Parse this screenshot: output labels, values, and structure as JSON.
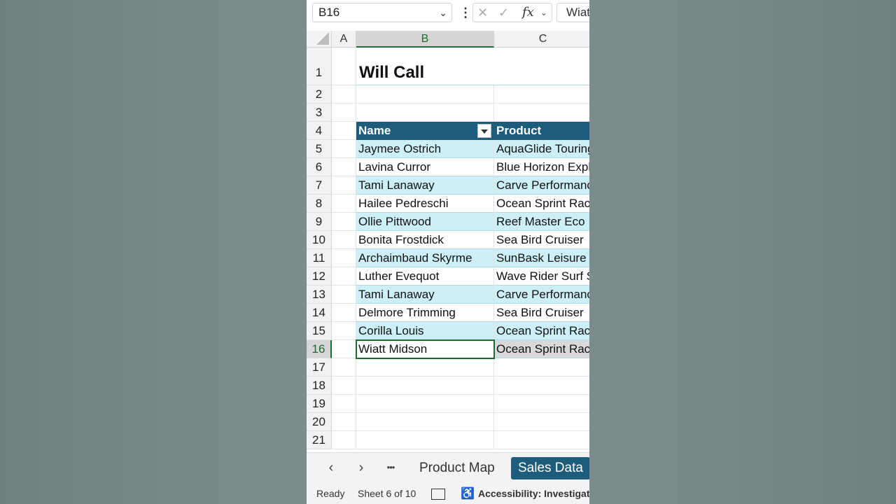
{
  "formula_bar": {
    "name_box": "B16",
    "formula_value": "Wiatt Midson",
    "icons": [
      "cancel-icon",
      "enter-icon",
      "fx-icon",
      "chevron-down-icon",
      "more-vertical-icon"
    ]
  },
  "columns": [
    "A",
    "B",
    "C"
  ],
  "rows": [
    "1",
    "2",
    "3",
    "4",
    "5",
    "6",
    "7",
    "8",
    "9",
    "10",
    "11",
    "12",
    "13",
    "14",
    "15",
    "16",
    "17",
    "18",
    "19",
    "20",
    "21"
  ],
  "sheet": {
    "title": "Will Call",
    "table": {
      "headers": [
        "Name",
        "Product"
      ],
      "rows": [
        [
          "Jaymee Ostrich",
          "AquaGlide Touring"
        ],
        [
          "Lavina Curror",
          "Blue Horizon Explorer"
        ],
        [
          "Tami Lanaway",
          "Carve Performance"
        ],
        [
          "Hailee Pedreschi",
          "Ocean Sprint Racer"
        ],
        [
          "Ollie Pittwood",
          "Reef Master Eco"
        ],
        [
          "Bonita Frostdick",
          "Sea Bird Cruiser"
        ],
        [
          "Archaimbaud Skyrme",
          "SunBask Leisure"
        ],
        [
          "Luther Evequot",
          "Wave Rider Surf Ski"
        ],
        [
          "Tami Lanaway",
          "Carve Performance"
        ],
        [
          "Delmore Trimming",
          "Sea Bird Cruiser"
        ],
        [
          "Corilla Louis",
          "Ocean Sprint Racer"
        ],
        [
          "Wiatt Midson",
          "Ocean Sprint Racer"
        ]
      ]
    }
  },
  "tabs": {
    "prev": "‹",
    "next": "›",
    "more": "•••",
    "items": [
      "Product Map",
      "Sales Data"
    ],
    "active": "Sales Data"
  },
  "status": {
    "ready": "Ready",
    "sheet_of": "Sheet 6 of 10",
    "accessibility": "Accessibility: Investigate"
  },
  "colors": {
    "table_header": "#1d5c7a",
    "band": "#cdf0f8",
    "selection": "#1e6b2e"
  }
}
